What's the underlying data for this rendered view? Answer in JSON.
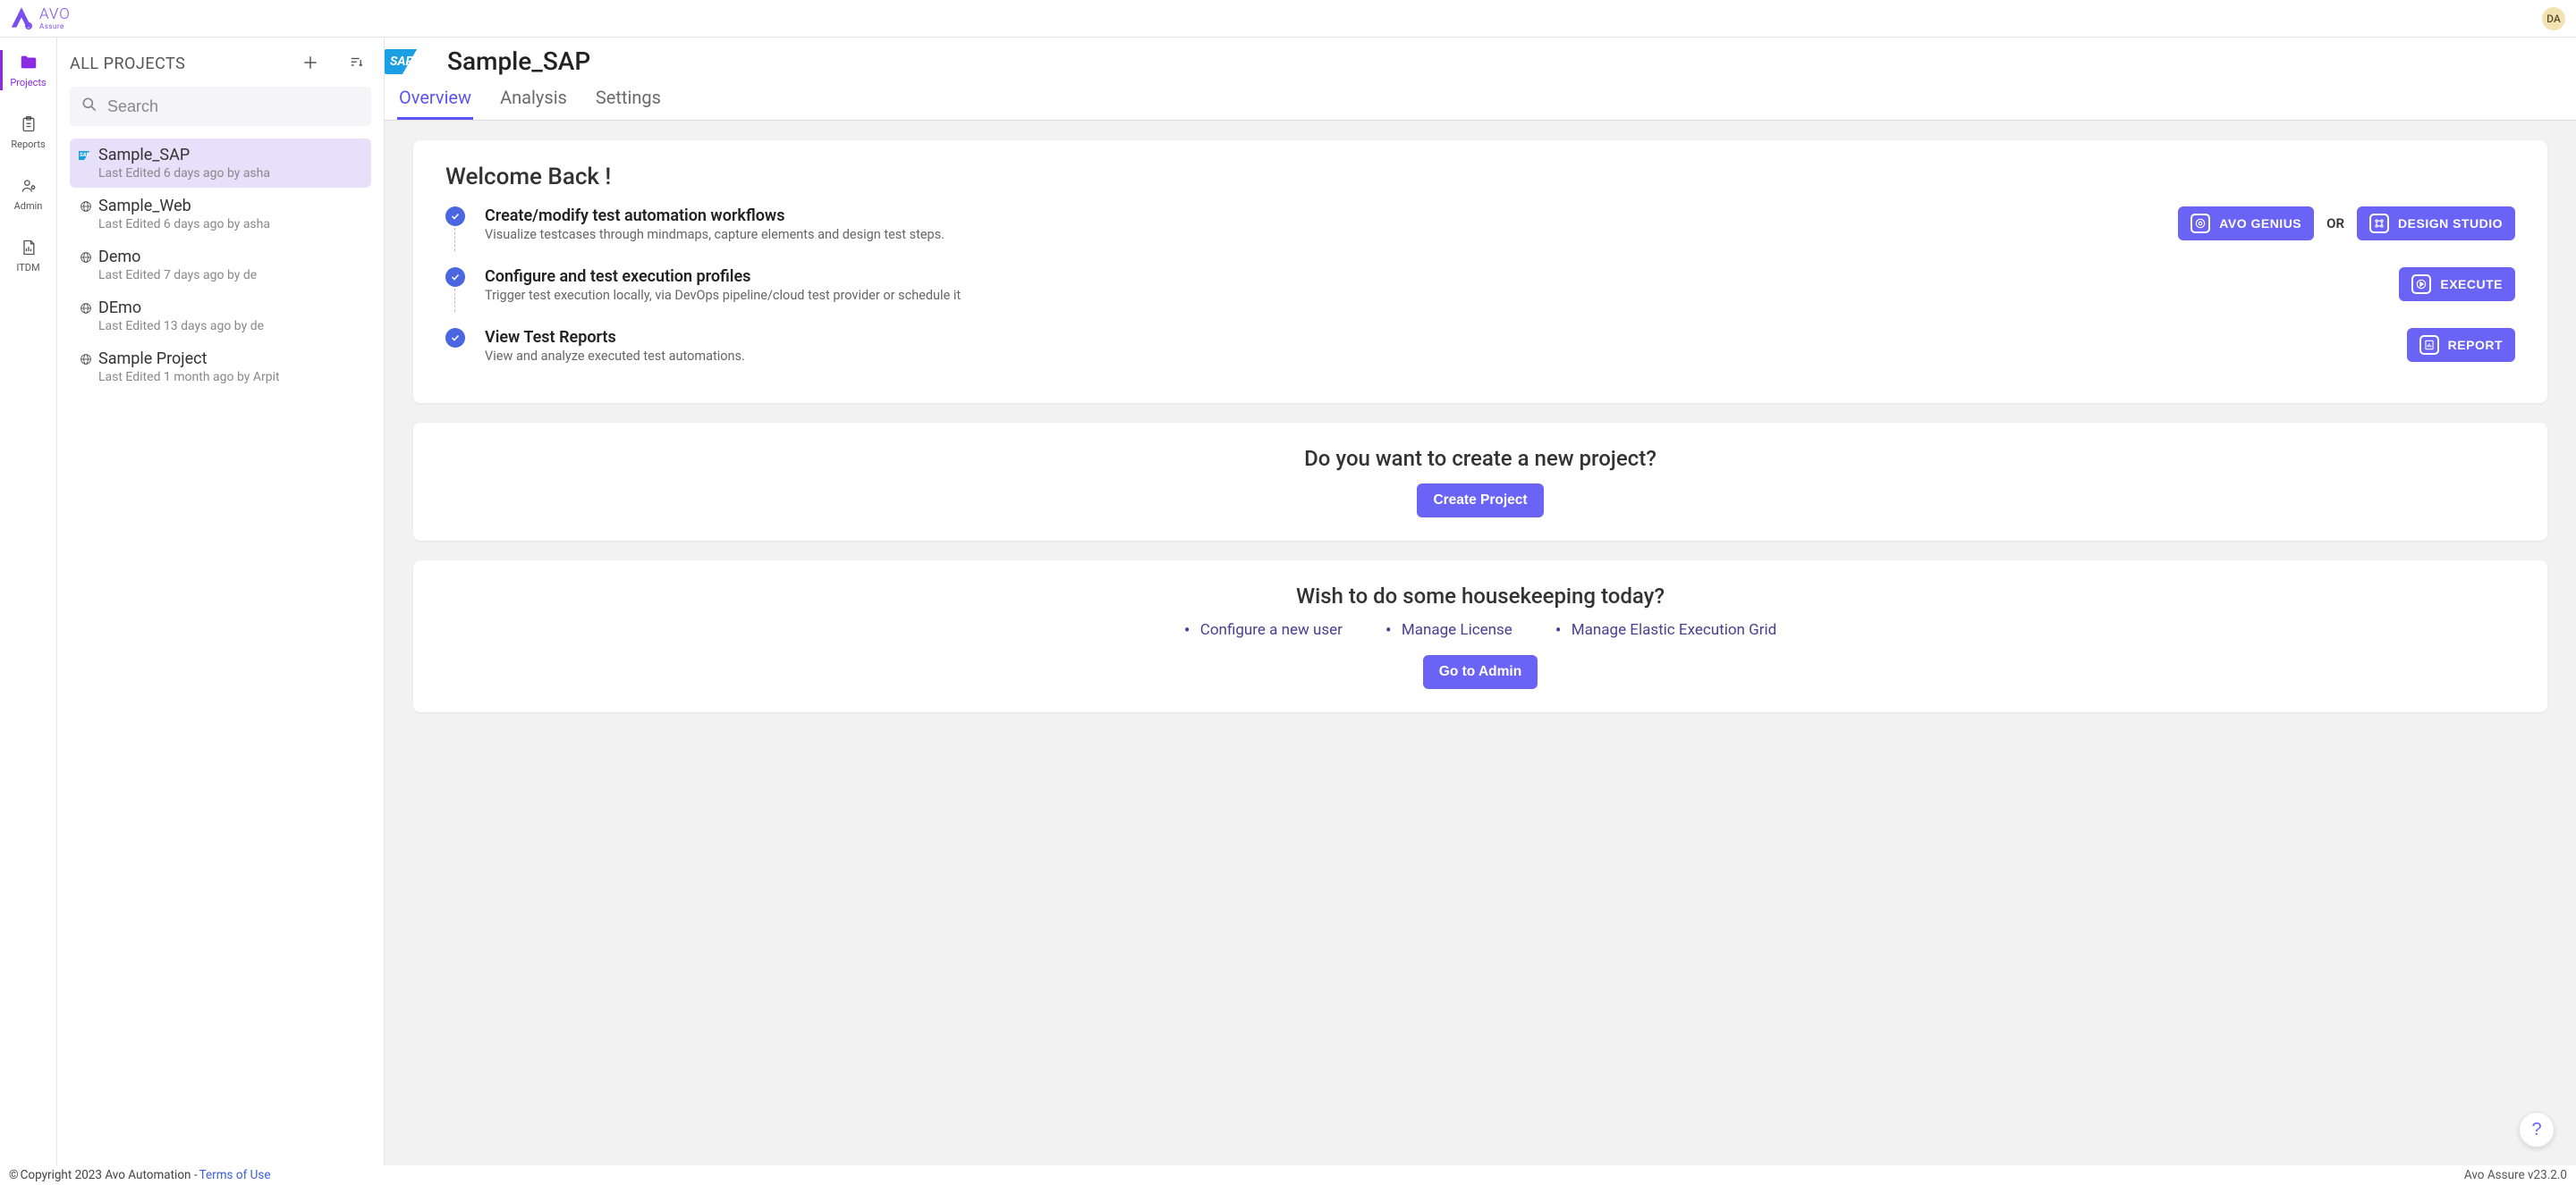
{
  "brand": {
    "name": "AVO",
    "sub": "Assure"
  },
  "user": {
    "initials": "DA"
  },
  "rail": {
    "items": [
      {
        "key": "projects",
        "label": "Projects",
        "active": true
      },
      {
        "key": "reports",
        "label": "Reports",
        "active": false
      },
      {
        "key": "admin",
        "label": "Admin",
        "active": false
      },
      {
        "key": "itdm",
        "label": "ITDM",
        "active": false
      }
    ]
  },
  "projects_panel": {
    "title": "ALL PROJECTS",
    "search_placeholder": "Search",
    "items": [
      {
        "type": "sap",
        "name": "Sample_SAP",
        "sub": "Last Edited 6 days ago by asha",
        "selected": true
      },
      {
        "type": "web",
        "name": "Sample_Web",
        "sub": "Last Edited 6 days ago by asha",
        "selected": false
      },
      {
        "type": "web",
        "name": "Demo",
        "sub": "Last Edited 7 days ago by de",
        "selected": false
      },
      {
        "type": "web",
        "name": "DEmo",
        "sub": "Last Edited 13 days ago by de",
        "selected": false
      },
      {
        "type": "web",
        "name": "Sample Project",
        "sub": "Last Edited 1 month ago by Arpit",
        "selected": false
      }
    ]
  },
  "content": {
    "project_name": "Sample_SAP",
    "tabs": [
      {
        "label": "Overview",
        "active": true
      },
      {
        "label": "Analysis",
        "active": false
      },
      {
        "label": "Settings",
        "active": false
      }
    ],
    "welcome": {
      "title": "Welcome Back !",
      "steps": [
        {
          "title": "Create/modify test automation workflows",
          "desc": "Visualize testcases through mindmaps, capture elements and design test steps.",
          "buttons": [
            "AVO GENIUS",
            "DESIGN STUDIO"
          ],
          "sep": "OR"
        },
        {
          "title": "Configure and test execution profiles",
          "desc": "Trigger test execution locally, via DevOps pipeline/cloud test provider or schedule it",
          "buttons": [
            "EXECUTE"
          ]
        },
        {
          "title": "View Test Reports",
          "desc": "View and analyze executed test automations.",
          "buttons": [
            "REPORT"
          ]
        }
      ]
    },
    "create_card": {
      "title": "Do you want to create a new project?",
      "button": "Create Project"
    },
    "house_card": {
      "title": "Wish to do some housekeeping today?",
      "links": [
        "Configure a new user",
        "Manage License",
        "Manage Elastic Execution Grid"
      ],
      "button": "Go to Admin"
    }
  },
  "help_fab": "?",
  "footer": {
    "copyright": "Copyright 2023 Avo Automation -",
    "terms": "Terms of Use",
    "version": "Avo Assure v23.2.0"
  }
}
